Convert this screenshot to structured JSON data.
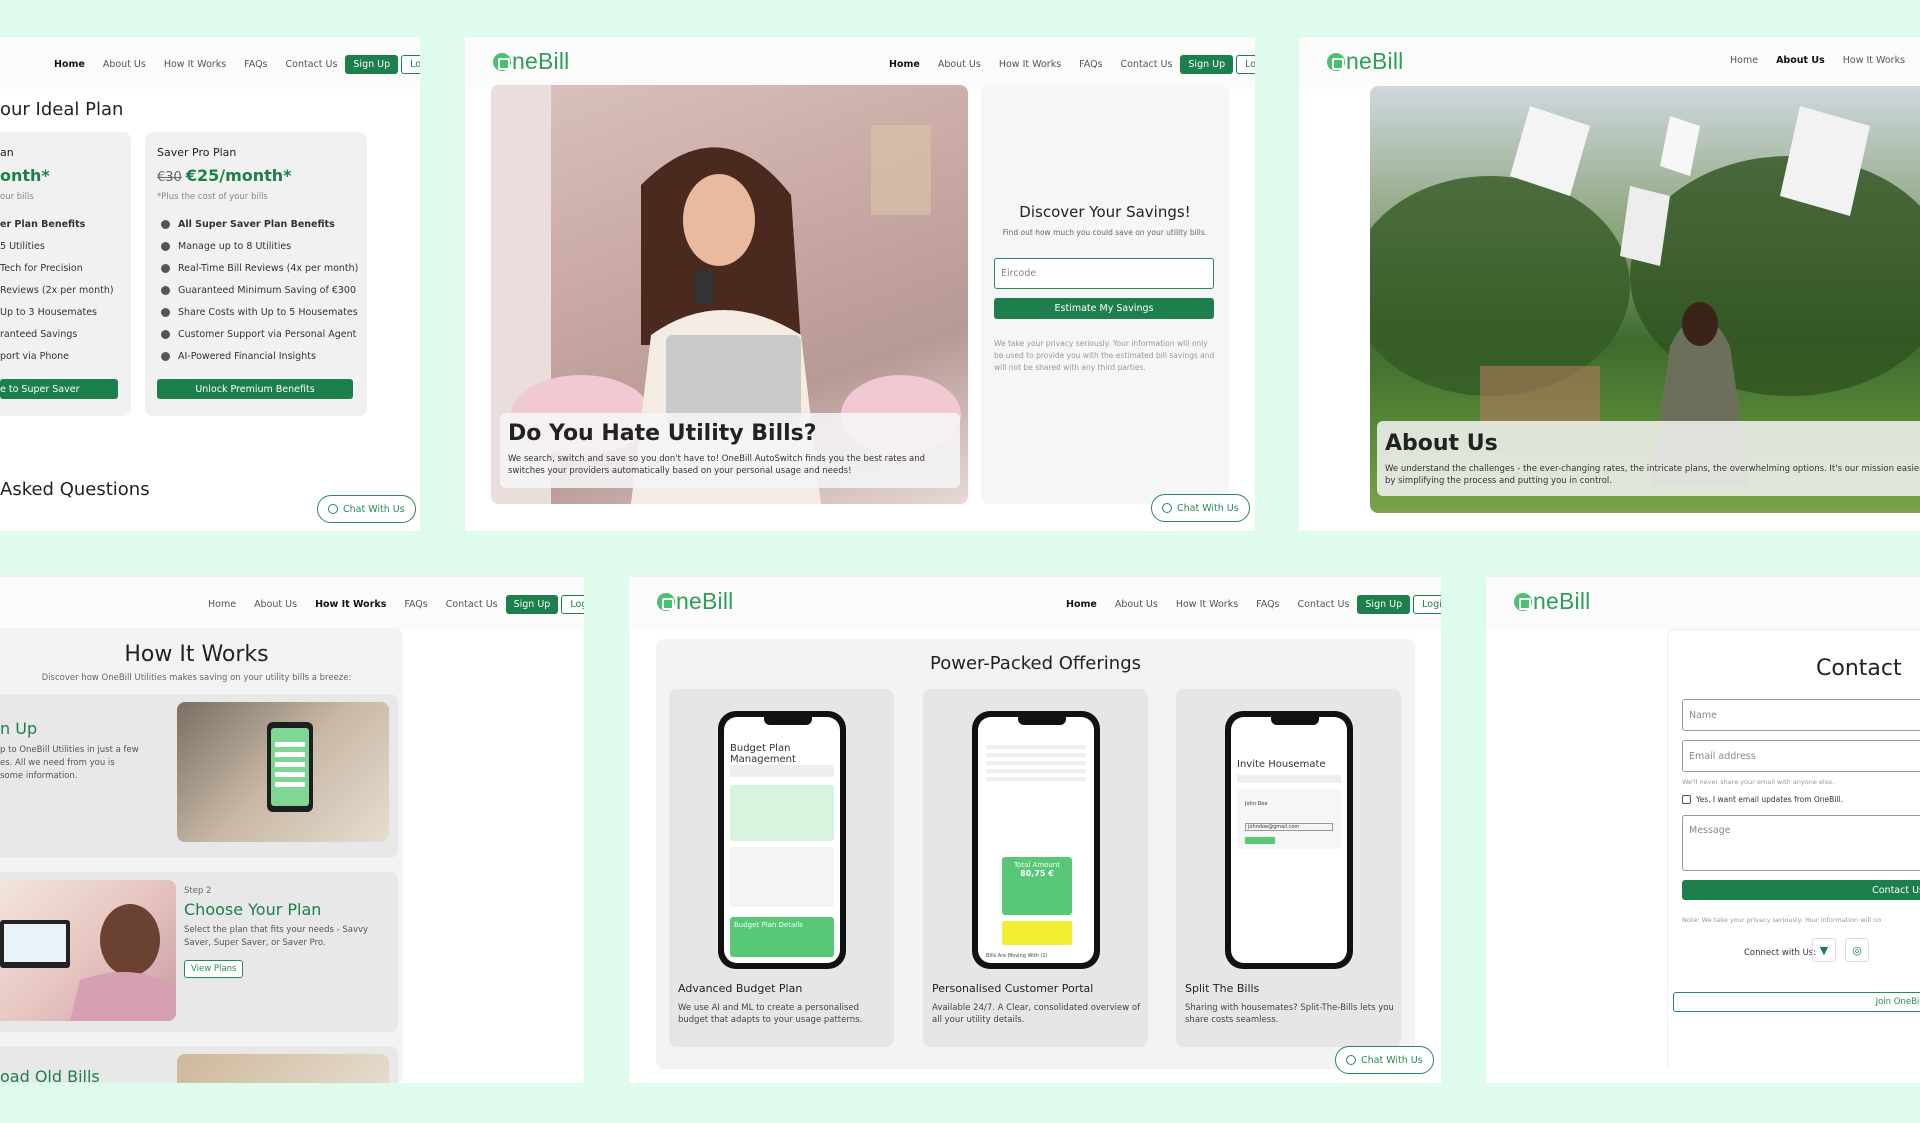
{
  "nav": {
    "home": "Home",
    "about": "About Us",
    "how": "How It Works",
    "faqs": "FAQs",
    "contact": "Contact Us",
    "signup": "Sign Up",
    "login": "Login"
  },
  "brand": {
    "name": "neBill",
    "accent": "#1d7f4b",
    "bg": "#dffbec"
  },
  "chat_label": "Chat With Us",
  "pricing": {
    "title": "our Ideal Plan",
    "plan_a": {
      "name": "an",
      "price": "onth*",
      "note": "our bills",
      "features": [
        "er Plan Benefits",
        "5 Utilities",
        "Tech for Precision",
        "Reviews (2x per month)",
        "Up to 3 Housemates",
        "ranteed Savings",
        "port via Phone"
      ],
      "cta": "e to Super Saver"
    },
    "plan_b": {
      "name": "Saver Pro Plan",
      "old_price": "€30",
      "price": "€25/month*",
      "note": "*Plus the cost of your bills",
      "features": [
        "All Super Saver Plan Benefits",
        "Manage up to 8 Utilities",
        "Real-Time Bill Reviews (4x per month)",
        "Guaranteed Minimum Saving of €300",
        "Share Costs with Up to 5 Housemates",
        "Customer Support via Personal Agent",
        "AI-Powered Financial Insights"
      ],
      "cta": "Unlock Premium Benefits"
    },
    "faq_title": "Asked Questions"
  },
  "hero": {
    "title": "Do You Hate Utility Bills?",
    "text": "We search, switch and save so you don't have to! OneBill AutoSwitch finds you the best rates and switches your providers automatically based on your personal usage and needs!",
    "savings_title": "Discover Your Savings!",
    "savings_sub": "Find out how much you could save on your utility bills.",
    "eircode_placeholder": "Eircode",
    "estimate_btn": "Estimate My Savings",
    "privacy": "We take your privacy seriously. Your information will only be used to provide you with the estimated bill savings and will not be shared with any third parties."
  },
  "about": {
    "title": "About Us",
    "text": "We understand the challenges - the ever-changing rates, the intricate plans, the overwhelming options. It's our mission easier by simplifying the process and putting you in control."
  },
  "how": {
    "title": "How It Works",
    "sub": "Discover how OneBill Utilities makes saving on your utility bills a breeze:",
    "step1_title": "n Up",
    "step1_text": "p to OneBill Utilities in just a few es. All we need from you is some information.",
    "step2_label": "Step 2",
    "step2_title": "Choose Your Plan",
    "step2_text": "Select the plan that fits your needs - Savvy Saver, Super Saver, or Saver Pro.",
    "step2_btn": "View Plans",
    "step3_title": "oad Old Bills"
  },
  "offerings": {
    "title": "Power-Packed Offerings",
    "items": [
      {
        "title": "Advanced Budget Plan",
        "text": "We use AI and ML to create a personalised budget that adapts to your usage patterns.",
        "screen_title": "Budget Plan Management",
        "screen_box": "Budget Plan Details"
      },
      {
        "title": "Personalised Customer Portal",
        "text": "Available 24/7. A Clear, consolidated overview of all your utility details.",
        "screen_total": "Total Amount",
        "screen_value": "80,75 €",
        "screen_footer": "Bills Are Moving With (1)"
      },
      {
        "title": "Split The Bills",
        "text": "Sharing with housemates? Split-The-Bills lets you share costs seamless.",
        "screen_title": "Invite Housemate",
        "screen_name": "John Doe",
        "screen_email": "johndoe@gmail.com"
      }
    ]
  },
  "contact": {
    "title": "Contact",
    "name_placeholder": "Name",
    "email_placeholder": "Email address",
    "email_note": "We'll never share your email with anyone else.",
    "checkbox_label": "Yes, I want email updates from OneBill.",
    "message_placeholder": "Message",
    "submit": "Contact Us",
    "note": "Note: We take your privacy seriously. Your information will no",
    "connect": "Connect with Us:",
    "join": "Join OneBill"
  }
}
